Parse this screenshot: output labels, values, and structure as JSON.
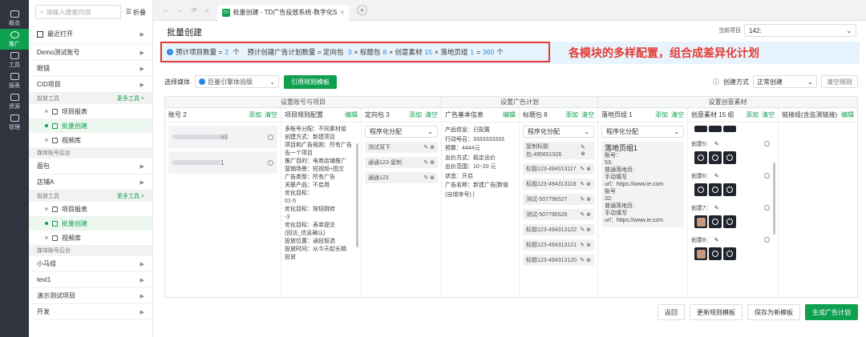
{
  "rail": [
    {
      "label": "概览",
      "icon": "dashboard-icon",
      "active": false
    },
    {
      "label": "推广",
      "icon": "promote-icon",
      "active": true
    },
    {
      "label": "工具",
      "icon": "tools-icon",
      "active": false
    },
    {
      "label": "报表",
      "icon": "report-icon",
      "active": false
    },
    {
      "label": "资源",
      "icon": "resource-icon",
      "active": false
    },
    {
      "label": "管理",
      "icon": "manage-icon",
      "active": false
    }
  ],
  "sidebar": {
    "search_placeholder": "请输入搜索内容",
    "fold": "折叠",
    "recent": "最近打开",
    "accounts": [
      {
        "label": "Demo测试账号"
      },
      {
        "label": "眼镜"
      },
      {
        "label": "CID项目"
      }
    ],
    "group1": {
      "title": "投放工具",
      "more": "更多工具 >",
      "items": [
        "项目报表",
        "批量创建",
        "视频库"
      ]
    },
    "group1_sec2": "媒体账号后台",
    "accounts2": [
      {
        "label": "面包"
      },
      {
        "label": "店铺A"
      }
    ],
    "group2": {
      "title": "投放工具",
      "more": "更多工具 >",
      "items": [
        "项目报表",
        "批量创建",
        "视频库"
      ]
    },
    "group2_sec2": "媒体账号后台",
    "accounts3": [
      {
        "label": "小马组"
      },
      {
        "label": "text1"
      },
      {
        "label": "演示测试项目"
      },
      {
        "label": "开发"
      }
    ]
  },
  "tabbar": {
    "tab_label": "批量创建 - TD广告投放系统-数字化S",
    "fav": "TD"
  },
  "page": {
    "title": "批量创建",
    "project_label": "当前项目",
    "project_value": "142:",
    "info": {
      "p1": "预计项目数量 = ",
      "n1": "2",
      "p2": " 个    预计创建广告计划数量 = 定向包 ",
      "n2": "3",
      "p3": " × 标题包 ",
      "n3": "8",
      "p4": " × 创意素材 ",
      "n4": "15",
      "p5": " × 落地页组 ",
      "n5": "1",
      "p6": " = ",
      "n6": "360",
      "p7": " 个"
    },
    "annotation": "各模块的多样配置，组合成差异化计划",
    "controls": {
      "media_label": "选择媒体",
      "media_value": "巨量引擎体验版",
      "apply_tpl": "引用规则模板",
      "create_mode_label": "创建方式",
      "create_mode_value": "正常创建",
      "clear": "清空规则"
    },
    "groups": [
      "设置账号与项目",
      "设置广告计划",
      "设置创意素材"
    ],
    "columns": {
      "account": {
        "title": "账号 2",
        "add": "添加",
        "clear": "清空"
      },
      "rule": {
        "title": "项目规则配置",
        "edit": "编辑"
      },
      "target": {
        "title": "定向包 3",
        "add": "添加",
        "clear": "清空"
      },
      "base": {
        "title": "广告基本信息",
        "edit": "编辑"
      },
      "titles": {
        "title": "标题包 8",
        "add": "添加",
        "clear": "清空"
      },
      "landing": {
        "title": "落地页组 1",
        "add": "添加",
        "clear": "清空"
      },
      "creative": {
        "title": "创意素材 15 组",
        "add": "添加",
        "clear": "清空"
      },
      "link": {
        "title": "链接组(含监测链接)",
        "edit": "编辑"
      }
    },
    "accounts_rows": [
      {
        "suffix": "69"
      },
      {
        "suffix": "1"
      }
    ],
    "rule_lines": [
      {
        "k": "多账号分配：",
        "v": "不同素材组"
      },
      {
        "k": "创建方式：",
        "v": "新建项目"
      },
      {
        "k": "项目和广告规则：",
        "v": "所有广告"
      },
      {
        "k": "",
        "v": "告一个项目"
      },
      {
        "k": "推广目的：",
        "v": "电商店铺推广"
      },
      {
        "k": "营销场景：",
        "v": "短视频+图文"
      },
      {
        "k": "广告类型：",
        "v": "所有广告"
      },
      {
        "k": "关联产品：",
        "v": "不启用"
      },
      {
        "k": "优化目标：",
        "v": ""
      },
      {
        "k": "",
        "v": "01-5"
      },
      {
        "k": "优化目标：",
        "v": "按钮跳转"
      },
      {
        "k": "",
        "v": "-3"
      },
      {
        "k": "优化目标：",
        "v": "表单提交"
      },
      {
        "k": "",
        "v": "(回访_信息确认)"
      },
      {
        "k": "投放位置：",
        "v": "通投智选"
      },
      {
        "k": "投放时间：",
        "v": "从今天起长期"
      },
      {
        "k": "",
        "v": "投放"
      }
    ],
    "target_select": "程序化分配",
    "targets": [
      "测试双下",
      "通通123-复制",
      "通通123"
    ],
    "base_lines": [
      {
        "k": "产品信息：",
        "v": "已配置"
      },
      {
        "k": "行动号召：",
        "v": "3333333333"
      },
      {
        "k": "预算：",
        "v": "4444元"
      },
      {
        "k": "出价方式：",
        "v": "稳定出价"
      },
      {
        "k": "出价范围：",
        "v": "10~20 元"
      },
      {
        "k": "状态：",
        "v": "开启"
      },
      {
        "k": "广告名称：",
        "v": "新建广告[数值"
      },
      {
        "k": "",
        "v": "(自增序号) ]"
      }
    ],
    "title_select": "程序化分配",
    "titles": [
      "复制标题包-495651926",
      "标题123-494313117",
      "标题123-494313118",
      "测试-507796527",
      "测试-507796528",
      "标题123-494313122",
      "标题123-494313121",
      "标题123-494313120"
    ],
    "landing_select": "程序化分配",
    "landing": {
      "name": "落地页组1",
      "lines": [
        "账号：",
        "53:",
        "普通落地页:",
        "手动填写",
        "url：https://www.ie.com",
        "账号",
        "32:",
        "普通落地页:",
        "手动填写",
        "url：https://www.ie.com"
      ]
    },
    "creatives": [
      "创意5：",
      "创意6：",
      "创意7：",
      "创意8："
    ],
    "buttons": {
      "back": "返回",
      "update_tpl": "更新规则模板",
      "save_tpl": "保存为新模板",
      "generate": "生成广告计划"
    }
  },
  "colors": {
    "green": "#0e9f4f",
    "blue": "#2b86e3",
    "red": "#e43a33"
  }
}
